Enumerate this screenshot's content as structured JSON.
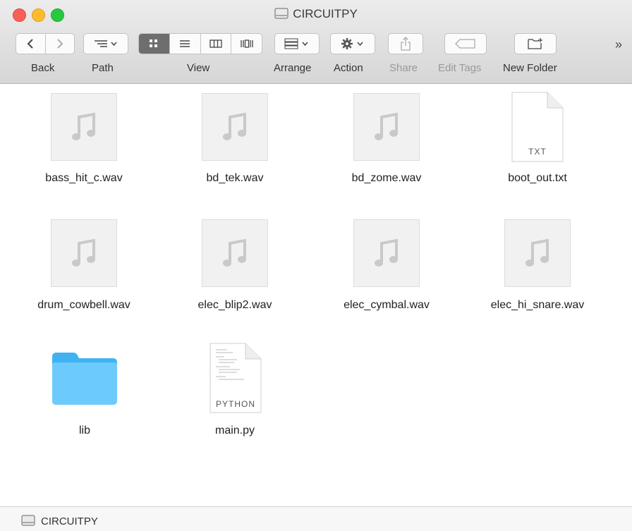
{
  "window": {
    "title": "CIRCUITPY",
    "icon": "disk-icon"
  },
  "toolbar": {
    "back_label": "Back",
    "path_label": "Path",
    "view_label": "View",
    "arrange_label": "Arrange",
    "action_label": "Action",
    "share_label": "Share",
    "edit_tags_label": "Edit Tags",
    "new_folder_label": "New Folder",
    "overflow": "»"
  },
  "files": [
    {
      "name": "bass_hit_c.wav",
      "kind": "audio"
    },
    {
      "name": "bd_tek.wav",
      "kind": "audio"
    },
    {
      "name": "bd_zome.wav",
      "kind": "audio"
    },
    {
      "name": "boot_out.txt",
      "kind": "text",
      "badge": "TXT"
    },
    {
      "name": "drum_cowbell.wav",
      "kind": "audio"
    },
    {
      "name": "elec_blip2.wav",
      "kind": "audio"
    },
    {
      "name": "elec_cymbal.wav",
      "kind": "audio"
    },
    {
      "name": "elec_hi_snare.wav",
      "kind": "audio"
    },
    {
      "name": "lib",
      "kind": "folder"
    },
    {
      "name": "main.py",
      "kind": "python",
      "badge": "PYTHON"
    }
  ],
  "status": {
    "path_label": "CIRCUITPY"
  },
  "colors": {
    "folder": "#5ac8fa",
    "accent": "#6e6e6e"
  }
}
